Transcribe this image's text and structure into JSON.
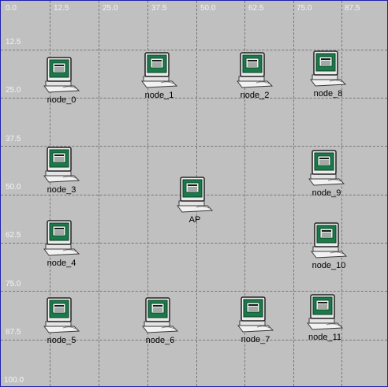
{
  "x_ticks": [
    "0.0",
    "12.5",
    "25.0",
    "37.5",
    "50.0",
    "62.5",
    "75.0",
    "87.5"
  ],
  "y_ticks": [
    "12.5",
    "25.0",
    "37.5",
    "50.0",
    "62.5",
    "75.0",
    "87.5",
    "100.0"
  ],
  "nodes": [
    {
      "id": "node_0",
      "label": "node_0"
    },
    {
      "id": "node_1",
      "label": "node_1"
    },
    {
      "id": "node_2",
      "label": "node_2"
    },
    {
      "id": "node_8",
      "label": "node_8"
    },
    {
      "id": "node_3",
      "label": "node_3"
    },
    {
      "id": "node_9",
      "label": "node_9"
    },
    {
      "id": "ap",
      "label": "AP"
    },
    {
      "id": "node_4",
      "label": "node_4"
    },
    {
      "id": "node_10",
      "label": "node_10"
    },
    {
      "id": "node_5",
      "label": "node_5"
    },
    {
      "id": "node_6",
      "label": "node_6"
    },
    {
      "id": "node_7",
      "label": "node_7"
    },
    {
      "id": "node_11",
      "label": "node_11"
    }
  ],
  "icon": "desktop-computer-icon",
  "colors": {
    "background": "#c0c0c0",
    "grid": "#777777",
    "screen": "#1a7a4a",
    "axis_text": "#f4f4f4"
  }
}
